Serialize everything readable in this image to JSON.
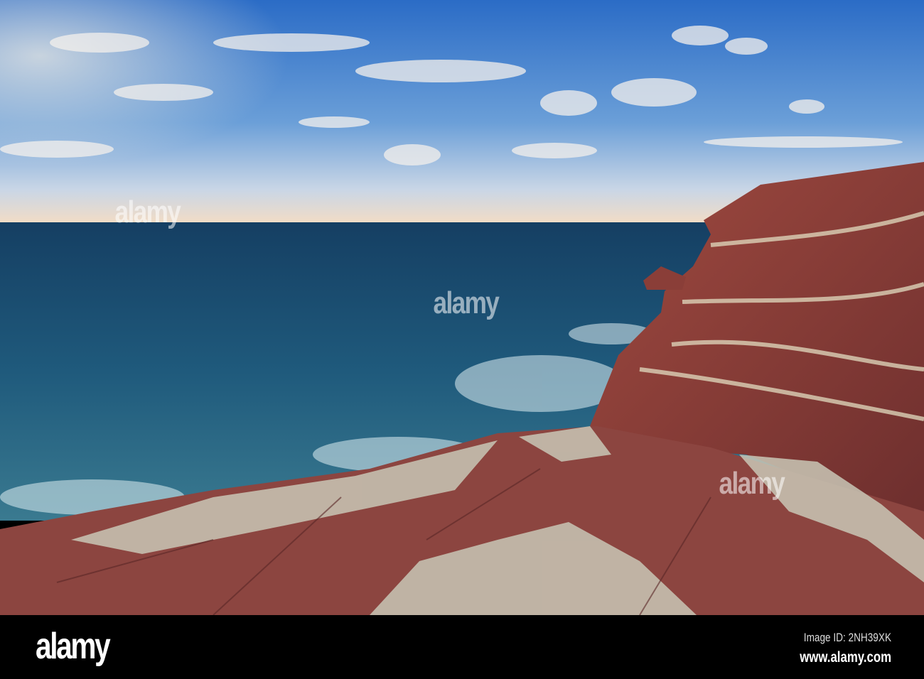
{
  "photo": {
    "subject": "Red layered sea cliffs over a blue sea at sunset"
  },
  "watermark": {
    "text": "alamy"
  },
  "footer": {
    "logo": "alamy",
    "image_id": "Image ID: 2NH39XK",
    "url": "www.alamy.com"
  },
  "colors": {
    "sky_top": "#2f6fc4",
    "horizon": "#f3dcc3",
    "sea": "#1c4a6b",
    "rock_red": "#8a3f3a",
    "rock_pale": "#c8c4b4"
  }
}
